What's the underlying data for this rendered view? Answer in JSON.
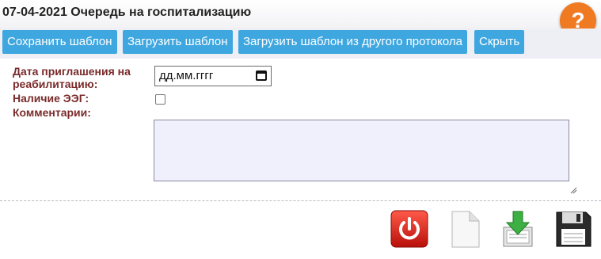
{
  "header": {
    "title": "07-04-2021 Очередь на госпитализацию",
    "help_symbol": "?"
  },
  "toolbar": {
    "buttons": [
      {
        "label": "Сохранить шаблон"
      },
      {
        "label": "Загрузить шаблон"
      },
      {
        "label": "Загрузить шаблон из другого протокола"
      },
      {
        "label": "Скрыть"
      }
    ]
  },
  "form": {
    "invite_date_label": "Дата приглашения на реабилитацию:",
    "invite_date_placeholder": "дд.мм.гггг",
    "eeg_label": "Наличие ЭЭГ:",
    "eeg_checked": false,
    "comments_label": "Комментарии:",
    "comments_value": ""
  },
  "actions": {
    "icons": [
      "power-icon",
      "blank-document-icon",
      "download-icon",
      "floppy-disk-icon"
    ]
  },
  "colors": {
    "button_bg": "#3fa7e0",
    "label_color": "#7a2a2a",
    "help_bg": "#f07a22",
    "toolbar_bg": "#eeeef5"
  }
}
